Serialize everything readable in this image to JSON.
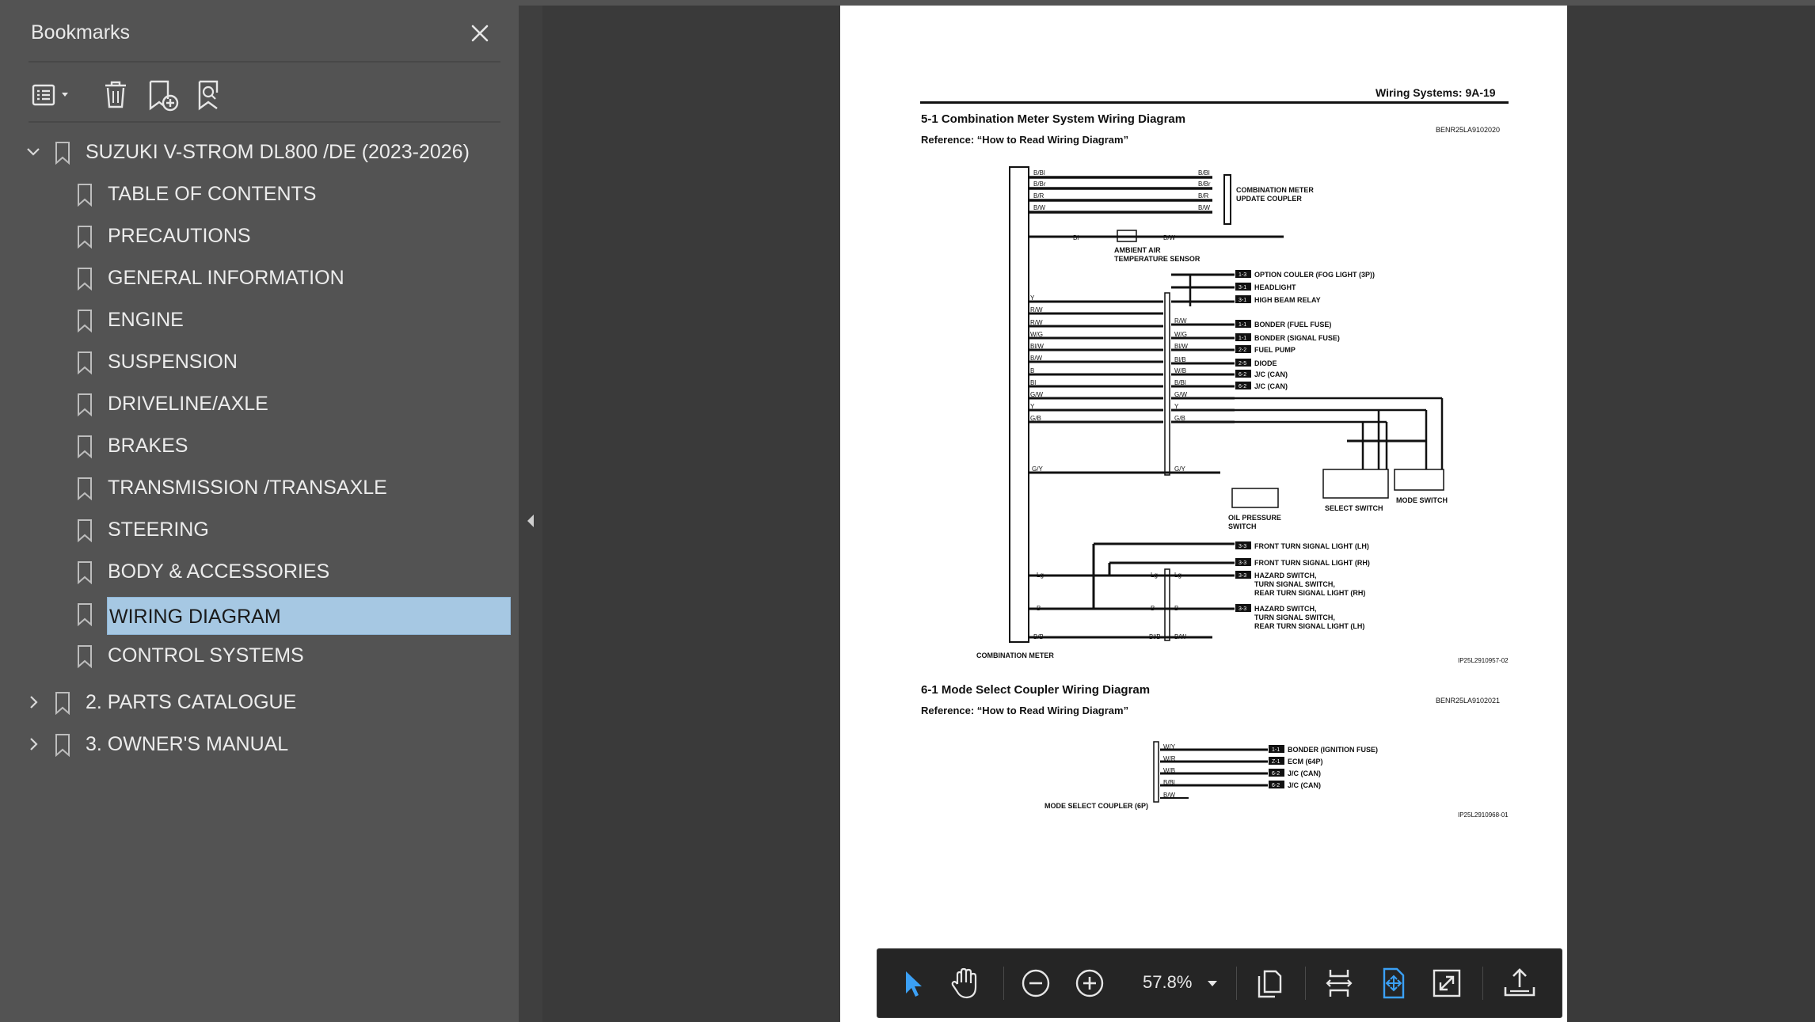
{
  "sidebar": {
    "title": "Bookmarks",
    "root": "SUZUKI V-STROM DL800 /DE (2023-2026)",
    "children": [
      "TABLE OF CONTENTS",
      "PRECAUTIONS",
      "GENERAL INFORMATION",
      "ENGINE",
      "SUSPENSION",
      "DRIVELINE/AXLE",
      "BRAKES",
      "TRANSMISSION /TRANSAXLE",
      "STEERING",
      "BODY & ACCESSORIES",
      "WIRING DIAGRAM",
      "CONTROL SYSTEMS"
    ],
    "selected": "WIRING DIAGRAM",
    "others": [
      "2. PARTS CATALOGUE",
      "3. OWNER'S MANUAL"
    ]
  },
  "document": {
    "header": "Wiring Systems:   9A-19",
    "section1_title": "5-1 Combination Meter System Wiring Diagram",
    "section1_ref": "Reference: “How to Read Wiring Diagram”",
    "section1_code": "BENR25LA9102020",
    "section1_fig": "IP25L2910957-02",
    "section2_title": "6-1 Mode Select Coupler Wiring Diagram",
    "section2_ref": "Reference: “How to Read Wiring Diagram”",
    "section2_code": "BENR25LA9102021",
    "section2_fig": "IP25L2910968-01",
    "labels": {
      "combo_coupler": "COMBINATION METER\nUPDATE COUPLER",
      "ambient": "AMBIENT AIR\nTEMPERATURE SENSOR",
      "option": "OPTION COULER (FOG LIGHT (3P))",
      "headlight": "HEADLIGHT",
      "highbeam": "HIGH BEAM RELAY",
      "fuel_fuse": "BONDER (FUEL FUSE)",
      "signal_fuse": "BONDER (SIGNAL FUSE)",
      "fuel_pump": "FUEL PUMP",
      "diode": "DIODE",
      "jc1": "J/C (CAN)",
      "jc2": "J/C (CAN)",
      "select_switch": "SELECT SWITCH",
      "mode_switch": "MODE SWITCH",
      "oil": "OIL PRESSURE\nSWITCH",
      "ftl_lh": "FRONT TURN SIGNAL LIGHT (LH)",
      "ftl_rh": "FRONT TURN SIGNAL LIGHT (RH)",
      "hazard1": "HAZARD SWITCH,\nTURN SIGNAL SWITCH,\nREAR TURN SIGNAL LIGHT (RH)",
      "hazard2": "HAZARD SWITCH,\nTURN SIGNAL SWITCH,\nREAR TURN SIGNAL LIGHT (LH)",
      "combo_meter": "COMBINATION METER",
      "ign_fuse": "BONDER (IGNITION FUSE)",
      "ecm": "ECM (64P)",
      "jc3": "J/C (CAN)",
      "jc4": "J/C (CAN)",
      "mode_coupler": "MODE SELECT COUPLER (6P)"
    }
  },
  "toolbar": {
    "zoom": "57.8%"
  }
}
